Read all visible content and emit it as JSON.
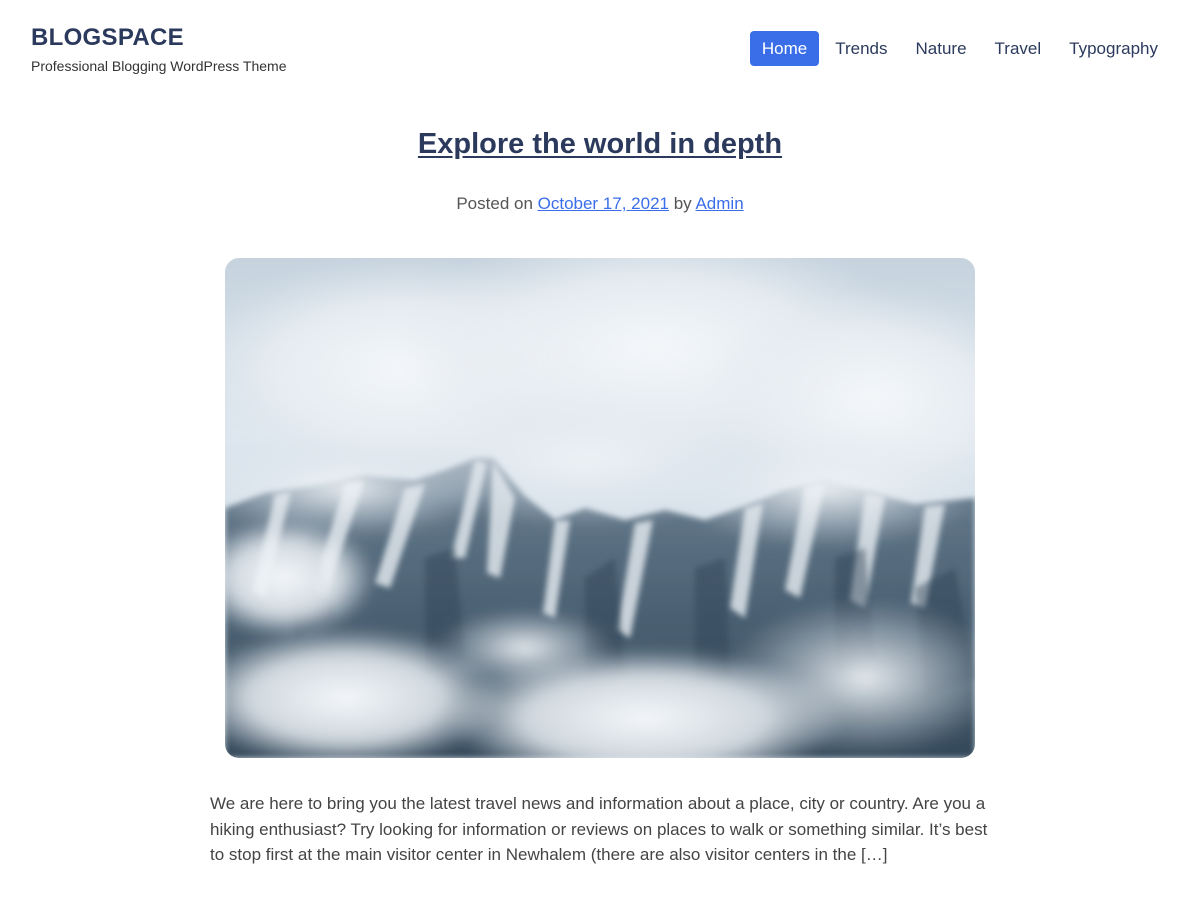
{
  "site": {
    "title": "BLOGSPACE",
    "tagline": "Professional Blogging WordPress Theme"
  },
  "nav": {
    "items": [
      {
        "label": "Home",
        "active": true
      },
      {
        "label": "Trends",
        "active": false
      },
      {
        "label": "Nature",
        "active": false
      },
      {
        "label": "Travel",
        "active": false
      },
      {
        "label": "Typography",
        "active": false
      }
    ]
  },
  "post": {
    "title": "Explore the world in depth",
    "meta": {
      "posted_on_text": "Posted on ",
      "date": "October 17, 2021",
      "by_text": " by ",
      "author": "Admin"
    },
    "image": {
      "subject": "snow-covered mountain ridge in clouds"
    },
    "excerpt": "We are here to bring you the latest travel news and information about a place, city or country. Are you a hiking enthusiast? Try looking for information or reviews on places to walk or something similar. It’s best to stop first at the main visitor center in Newhalem (there are also visitor centers in the […]"
  },
  "colors": {
    "accent": "#3a6ee8",
    "heading": "#2b3a5c",
    "text": "#444444"
  }
}
